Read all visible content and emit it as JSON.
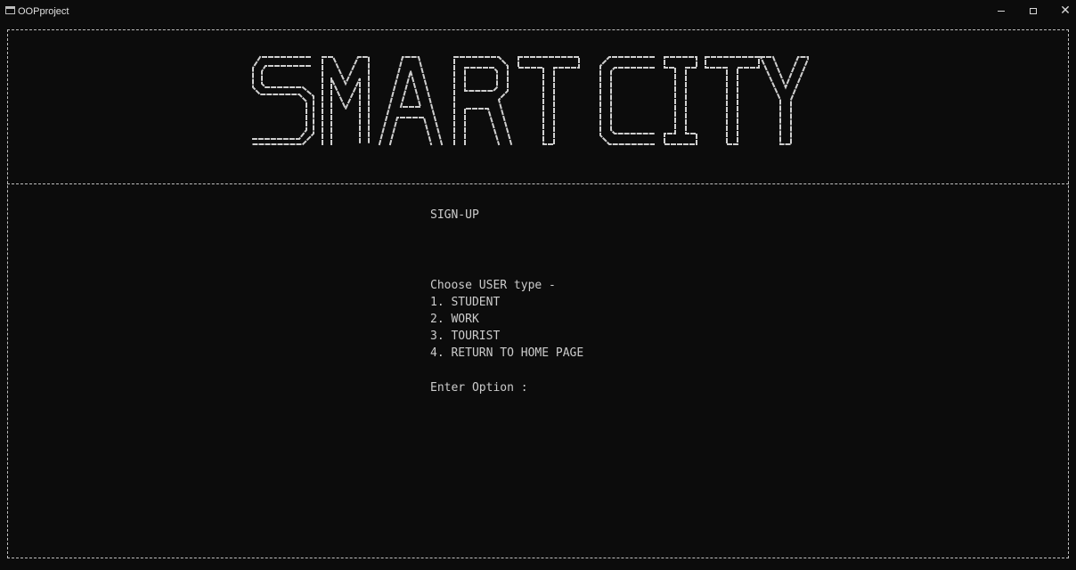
{
  "window": {
    "title": "OOPproject",
    "icon": "console-app-icon"
  },
  "controls": {
    "minimize_icon": "minimize-icon",
    "maximize_icon": "maximize-icon",
    "close_icon": "close-icon",
    "close_glyph": "✕"
  },
  "banner": {
    "text": "SMART CITY"
  },
  "screen": {
    "heading": "SIGN-UP",
    "prompt": "Choose USER type -",
    "options": [
      "1. STUDENT",
      "2. WORK",
      "3. TOURIST",
      "4. RETURN TO HOME PAGE"
    ],
    "input_prompt": "Enter Option :"
  },
  "colors": {
    "background": "#0c0c0c",
    "text": "#cccccc"
  }
}
